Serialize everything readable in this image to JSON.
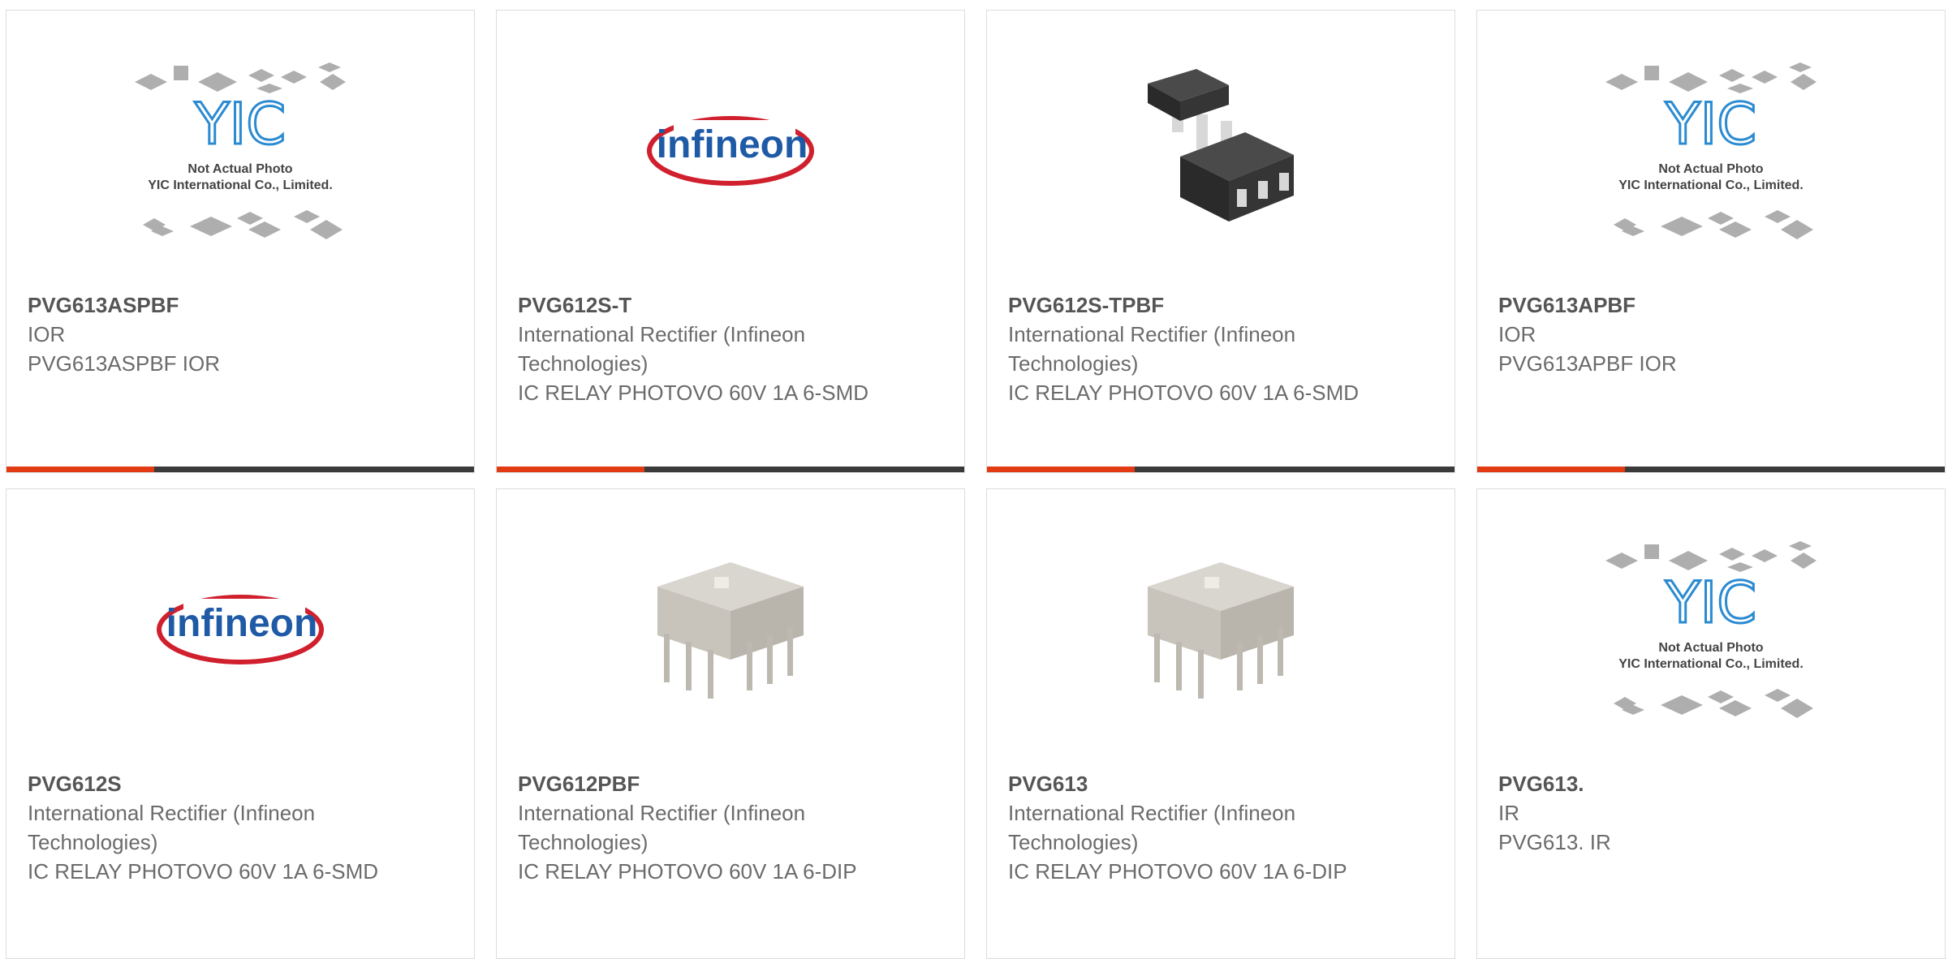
{
  "colors": {
    "accent": "#e23a13",
    "bar": "#3a3a3a",
    "infineon_blue": "#1f5aa6",
    "infineon_red": "#d0202e",
    "yic_blue": "#2b8bd1"
  },
  "placeholder": {
    "line1": "Not Actual Photo",
    "line2": "YIC International Co., Limited.",
    "logo": "YIC"
  },
  "infineon_logo": "infineon",
  "products": [
    {
      "part": "PVG613ASPBF",
      "maker": "IOR",
      "desc": "PVG613ASPBF IOR",
      "image": "yic-placeholder"
    },
    {
      "part": "PVG612S-T",
      "maker": "International Rectifier (Infineon Technologies)",
      "desc": "IC RELAY PHOTOVO 60V 1A 6-SMD",
      "image": "infineon-logo"
    },
    {
      "part": "PVG612S-TPBF",
      "maker": "International Rectifier (Infineon Technologies)",
      "desc": "IC RELAY PHOTOVO 60V 1A 6-SMD",
      "image": "smd-chip"
    },
    {
      "part": "PVG613APBF",
      "maker": "IOR",
      "desc": "PVG613APBF IOR",
      "image": "yic-placeholder"
    },
    {
      "part": "PVG612S",
      "maker": "International Rectifier (Infineon Technologies)",
      "desc": "IC RELAY PHOTOVO 60V 1A 6-SMD",
      "image": "infineon-logo"
    },
    {
      "part": "PVG612PBF",
      "maker": "International Rectifier (Infineon Technologies)",
      "desc": "IC RELAY PHOTOVO 60V 1A 6-DIP",
      "image": "dip-chip"
    },
    {
      "part": "PVG613",
      "maker": "International Rectifier (Infineon Technologies)",
      "desc": "IC RELAY PHOTOVO 60V 1A 6-DIP",
      "image": "dip-chip"
    },
    {
      "part": "PVG613.",
      "maker": "IR",
      "desc": "PVG613. IR",
      "image": "yic-placeholder"
    }
  ]
}
